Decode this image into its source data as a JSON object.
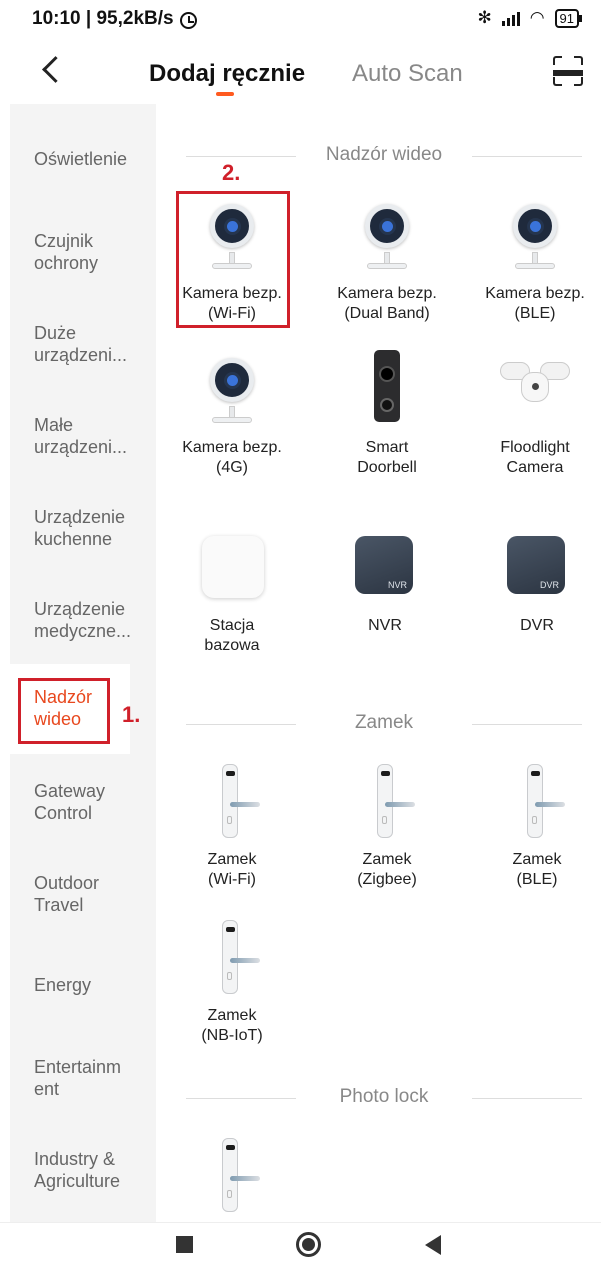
{
  "status": {
    "time_speed": "10:10 | 95,2kB/s",
    "battery": "91"
  },
  "header": {
    "tab_manual": "Dodaj ręcznie",
    "tab_scan": "Auto Scan"
  },
  "sidebar": {
    "items": [
      {
        "label": "Oświetlenie"
      },
      {
        "label": "Czujnik ochrony"
      },
      {
        "label": "Duże urządzeni..."
      },
      {
        "label": "Małe urządzeni..."
      },
      {
        "label": "Urządzenie kuchenne"
      },
      {
        "label": "Urządzenie medyczne..."
      },
      {
        "label": "Nadzór wideo"
      },
      {
        "label": "Gateway Control"
      },
      {
        "label": "Outdoor Travel"
      },
      {
        "label": "Energy"
      },
      {
        "label": "Entertainm ent"
      },
      {
        "label": "Industry & Agriculture"
      }
    ],
    "active_index": 6
  },
  "annotations": {
    "step1": "1.",
    "step2": "2."
  },
  "sections": [
    {
      "title": "Nadzór wideo",
      "devices": [
        {
          "line1": "Kamera bezp.",
          "line2": "(Wi-Fi)",
          "icon": "camera-icon"
        },
        {
          "line1": "Kamera bezp.",
          "line2": "(Dual Band)",
          "icon": "camera-icon"
        },
        {
          "line1": "Kamera bezp.",
          "line2": "(BLE)",
          "icon": "camera-icon"
        },
        {
          "line1": "Kamera bezp.",
          "line2": "(4G)",
          "icon": "camera-icon"
        },
        {
          "line1": "Smart",
          "line2": "Doorbell",
          "icon": "doorbell-icon"
        },
        {
          "line1": "Floodlight",
          "line2": "Camera",
          "icon": "floodlight-icon"
        },
        {
          "line1": "Stacja",
          "line2": "bazowa",
          "icon": "base-station-icon"
        },
        {
          "line1": "NVR",
          "line2": "",
          "icon": "nvr-icon",
          "badge": "NVR"
        },
        {
          "line1": "DVR",
          "line2": "",
          "icon": "dvr-icon",
          "badge": "DVR"
        }
      ]
    },
    {
      "title": "Zamek",
      "devices": [
        {
          "line1": "Zamek",
          "line2": "(Wi-Fi)",
          "icon": "lock-icon"
        },
        {
          "line1": "Zamek",
          "line2": "(Zigbee)",
          "icon": "lock-icon"
        },
        {
          "line1": "Zamek",
          "line2": "(BLE)",
          "icon": "lock-icon"
        },
        {
          "line1": "Zamek",
          "line2": "(NB-IoT)",
          "icon": "lock-icon"
        }
      ]
    },
    {
      "title": "Photo lock",
      "devices": [
        {
          "line1": "",
          "line2": "",
          "icon": "lock-icon"
        }
      ]
    }
  ],
  "colors": {
    "accent": "#ff5a1f",
    "annotation": "#d0202a",
    "sidebar_bg": "#f4f4f4"
  }
}
